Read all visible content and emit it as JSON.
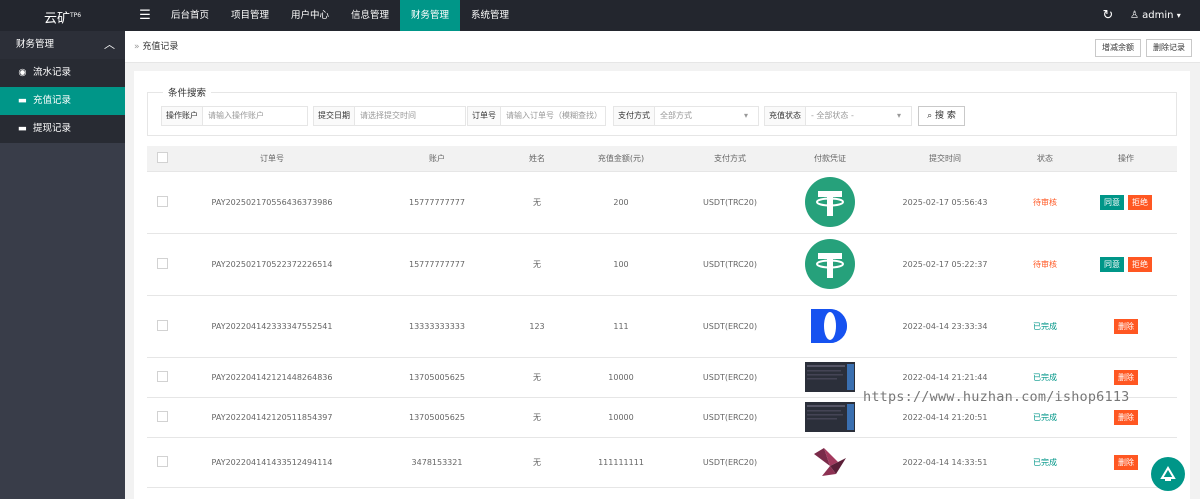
{
  "header": {
    "logo": "云矿",
    "logo_sup": "TP6",
    "menu_icon": "hamburger-icon",
    "nav": [
      "后台首页",
      "项目管理",
      "用户中心",
      "信息管理",
      "财务管理",
      "系统管理"
    ],
    "active_nav": "财务管理",
    "refresh_icon": "refresh-icon",
    "user": "admin",
    "user_icon": "user-icon"
  },
  "sidebar": {
    "section": "财务管理",
    "items": [
      {
        "label": "流水记录",
        "icon": "radio-icon"
      },
      {
        "label": "充值记录",
        "icon": "card-icon"
      },
      {
        "label": "提现记录",
        "icon": "card-icon"
      }
    ],
    "active": "充值记录"
  },
  "breadcrumb": {
    "label": "充值记录"
  },
  "toolbar": {
    "add_button": "增减余额",
    "delete_button": "删除记录"
  },
  "search": {
    "legend": "条件搜索",
    "account_label": "操作账户",
    "account_placeholder": "请输入操作账户",
    "date_label": "提交日期",
    "date_placeholder": "请选择提交时间",
    "order_label": "订单号",
    "order_placeholder": "请输入订单号（模糊查找）",
    "pay_label": "支付方式",
    "pay_value": "全部方式",
    "status_label": "充值状态",
    "status_value": "- 全部状态 -",
    "search_button": "搜 索"
  },
  "table": {
    "columns": [
      "订单号",
      "账户",
      "姓名",
      "充值金额(元)",
      "支付方式",
      "付款凭证",
      "提交时间",
      "状态",
      "操作"
    ],
    "rows": [
      {
        "order": "PAY20250217055643637398​6",
        "account": "15777777777",
        "name": "无",
        "amount": "200",
        "method": "USDT(TRC20)",
        "voucher": "tether-logo",
        "time": "2025-02-17 05:56:43",
        "status": "待审核",
        "actions": [
          "同意",
          "拒绝"
        ]
      },
      {
        "order": "PAY20250217052237222651​4",
        "account": "15777777777",
        "name": "无",
        "amount": "100",
        "method": "USDT(TRC20)",
        "voucher": "tether-logo",
        "time": "2025-02-17 05:22:37",
        "status": "待审核",
        "actions": [
          "同意",
          "拒绝"
        ]
      },
      {
        "order": "PAY20220414233334755254​1",
        "account": "13333333333",
        "name": "123",
        "amount": "111",
        "method": "USDT(ERC20)",
        "voucher": "blue-logo",
        "time": "2022-04-14 23:33:34",
        "status": "已完成",
        "actions": [
          "删除"
        ]
      },
      {
        "order": "PAY20220414212144826483​6",
        "account": "13705005625",
        "name": "无",
        "amount": "10000",
        "method": "USDT(ERC20)",
        "voucher": "screenshot-thumb",
        "time": "2022-04-14 21:21:44",
        "status": "已完成",
        "actions": [
          "删除"
        ]
      },
      {
        "order": "PAY20220414212051185439​7",
        "account": "13705005625",
        "name": "无",
        "amount": "10000",
        "method": "USDT(ERC20)",
        "voucher": "screenshot-thumb",
        "time": "2022-04-14 21:20:51",
        "status": "已完成",
        "actions": [
          "删除"
        ]
      },
      {
        "order": "PAY20220414143351249411​4",
        "account": "3478153321",
        "name": "无",
        "amount": "111111111",
        "method": "USDT(ERC20)",
        "voucher": "bird-logo",
        "time": "2022-04-14 14:33:51",
        "status": "已完成",
        "actions": [
          "删除"
        ]
      }
    ]
  },
  "watermark": "https://www.huzhan.com/ishop6113",
  "float_icon": "chat-icon"
}
